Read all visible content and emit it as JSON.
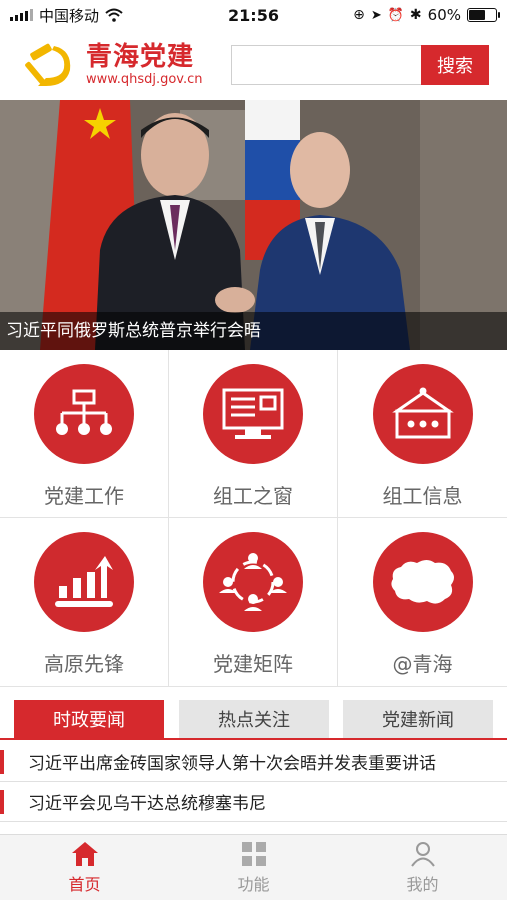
{
  "status_bar": {
    "carrier": "中国移动",
    "time": "21:56",
    "battery": "60%",
    "battery_level": 0.6
  },
  "header": {
    "title": "青海党建",
    "url": "www.qhsdj.gov.cn",
    "search_placeholder": "",
    "search_button": "搜索"
  },
  "banner": {
    "caption": "习近平同俄罗斯总统普京举行会晤"
  },
  "grid": [
    {
      "label": "党建工作",
      "icon": "org-chart-icon"
    },
    {
      "label": "组工之窗",
      "icon": "monitor-icon"
    },
    {
      "label": "组工信息",
      "icon": "info-board-icon"
    },
    {
      "label": "高原先锋",
      "icon": "growth-chart-icon"
    },
    {
      "label": "党建矩阵",
      "icon": "network-people-icon"
    },
    {
      "label": "@青海",
      "icon": "qinghai-map-icon"
    }
  ],
  "tabs": [
    "时政要闻",
    "热点关注",
    "党建新闻"
  ],
  "news": [
    "习近平出席金砖国家领导人第十次会晤并发表重要讲话",
    "习近平会见乌干达总统穆塞韦尼"
  ],
  "bottom_nav": [
    "首页",
    "功能",
    "我的"
  ],
  "colors": {
    "brand_red": "#d6292d",
    "gray_text": "#666666"
  }
}
